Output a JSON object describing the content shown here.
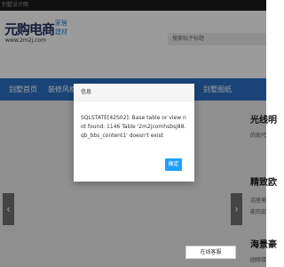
{
  "topbar": {
    "text": "别墅设计图"
  },
  "header": {
    "logo_text": "元购电商",
    "logo_url": "www.2m2j.com",
    "logo_tag1": "家居",
    "logo_tag2": "建材",
    "search_placeholder": "搜索帖子标题"
  },
  "nav": {
    "items": [
      {
        "label": "别墅首页"
      },
      {
        "label": "装修风格"
      },
      {
        "label": "别墅图纸"
      }
    ]
  },
  "sidebar": {
    "item1_title": "光线明",
    "item1_sub": "的现代",
    "item2_title": "精致欧",
    "item2_sub1": "这座美",
    "item2_sub2": "能的宏",
    "item3_title": "海景豪",
    "item3_sub": "园暗楼"
  },
  "dialog": {
    "title": "信息",
    "message": "SQLSTATE[42S02]: Base table or view not found: 1146 Table '2m2jcomhsbsj88.qb_bbs_content1' doesn't exist",
    "confirm_label": "确定"
  },
  "online_service": {
    "label": "在线客服"
  },
  "carousel": {
    "prev_glyph": "‹",
    "next_glyph": "›"
  }
}
